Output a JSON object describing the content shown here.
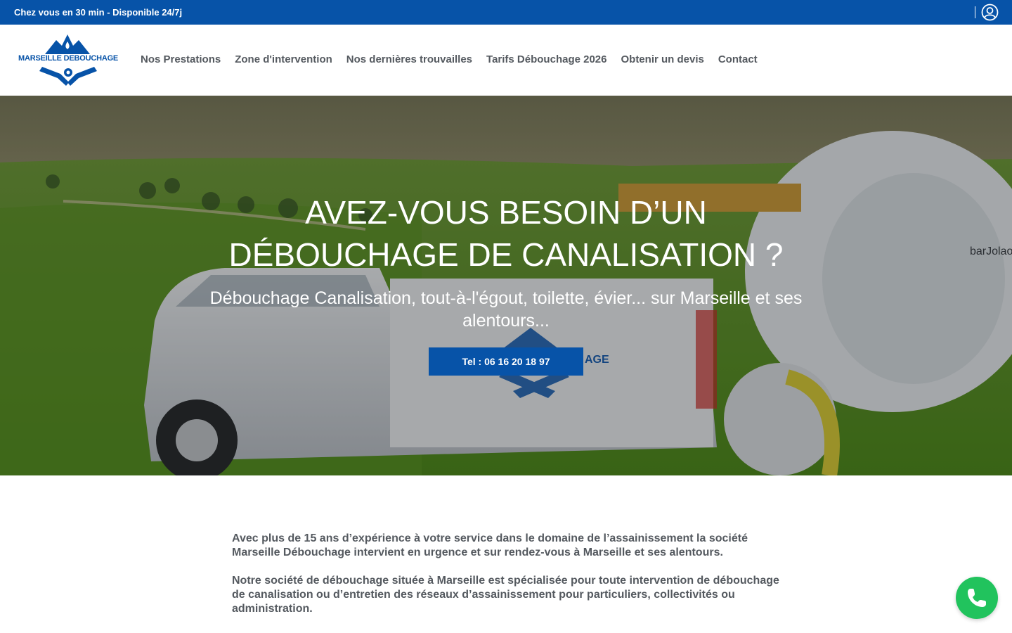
{
  "topbar": {
    "announcement": "Chez vous en 30 min - Disponible 24/7j",
    "account_icon": "user-circle-icon"
  },
  "header": {
    "logo_text": "MARSEILLE DEBOUCHAGE",
    "nav": [
      {
        "label": "Nos Prestations"
      },
      {
        "label": "Zone d'intervention"
      },
      {
        "label": "Nos dernières trouvailles"
      },
      {
        "label": "Tarifs Débouchage 2026"
      },
      {
        "label": "Obtenir un devis"
      },
      {
        "label": "Contact"
      }
    ]
  },
  "hero": {
    "title_line1": "AVEZ-VOUS BESOIN D’UN",
    "title_line2": "DÉBOUCHAGE DE CANALISATION ?",
    "subtitle": "Débouchage Canalisation, tout-à-l'égout, toilette, évier... sur Marseille et ses alentours...",
    "cta_label": "Tel : 06 16 20 18 97",
    "truck_brand": "barJolao",
    "truck_text": "AGE"
  },
  "content": {
    "paragraphs": [
      "Avec plus de 15 ans d’expérience à votre service dans le domaine de l’assainissement la société Marseille Débouchage intervient en urgence et sur rendez-vous à Marseille et ses alentours.",
      "Notre société de débouchage située à Marseille est spécialisée pour toute intervention de débouchage de canalisation ou d’entretien des réseaux d’assainissement pour particuliers, collectivités ou administration."
    ]
  },
  "floating": {
    "phone_icon": "phone-icon"
  },
  "colors": {
    "brand_blue": "#0753a8",
    "call_green": "#21c35d",
    "text_gray": "#54595f"
  }
}
